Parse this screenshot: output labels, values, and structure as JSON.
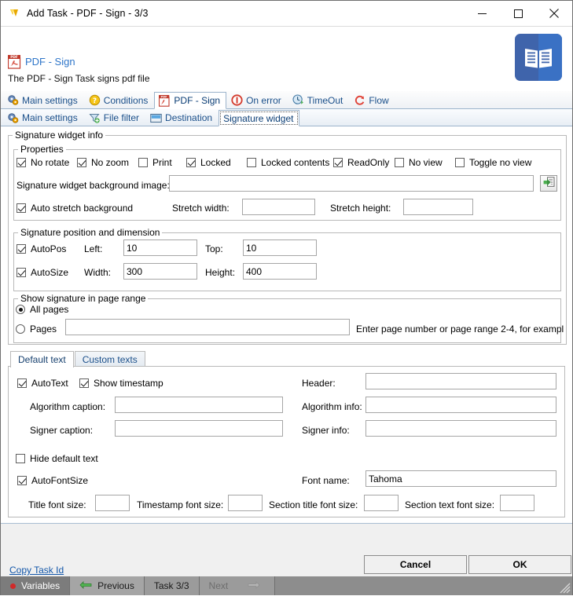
{
  "window": {
    "title": "Add Task - PDF - Sign - 3/3",
    "app_icon": "limagito-icon",
    "minimize": "minimize-icon",
    "maximize": "maximize-icon",
    "close": "close-icon"
  },
  "header": {
    "title": "PDF - Sign",
    "subtitle": "The PDF - Sign Task signs pdf file",
    "icon": "pdf-icon",
    "side_icon": "book-icon"
  },
  "tabs_primary": [
    {
      "label": "Main settings",
      "icon": "gears-icon",
      "active": false
    },
    {
      "label": "Conditions",
      "icon": "question-icon",
      "active": false
    },
    {
      "label": "PDF - Sign",
      "icon": "pdf-icon",
      "active": true
    },
    {
      "label": "On error",
      "icon": "error-icon",
      "active": false
    },
    {
      "label": "TimeOut",
      "icon": "timeout-icon",
      "active": false
    },
    {
      "label": "Flow",
      "icon": "flow-icon",
      "active": false
    }
  ],
  "tabs_secondary": [
    {
      "label": "Main settings",
      "icon": "gears-icon",
      "active": false
    },
    {
      "label": "File filter",
      "icon": "filter-icon",
      "active": false
    },
    {
      "label": "Destination",
      "icon": "destination-icon",
      "active": false
    },
    {
      "label": "Signature widget",
      "icon": "",
      "active": true
    }
  ],
  "groups": {
    "widget_info": "Signature widget info",
    "properties": "Properties",
    "position": "Signature position and dimension",
    "page_range": "Show signature in page range"
  },
  "properties": {
    "checks": [
      {
        "label": "No rotate",
        "checked": true
      },
      {
        "label": "No zoom",
        "checked": true
      },
      {
        "label": "Print",
        "checked": false
      },
      {
        "label": "Locked",
        "checked": true
      },
      {
        "label": "Locked contents",
        "checked": false
      },
      {
        "label": "ReadOnly",
        "checked": true
      },
      {
        "label": "No view",
        "checked": false
      },
      {
        "label": "Toggle no view",
        "checked": false
      }
    ],
    "background_image_label": "Signature widget background image:",
    "background_image_value": "",
    "browse_icon": "open-file-icon",
    "auto_stretch_label": "Auto stretch background",
    "auto_stretch_checked": true,
    "stretch_width_label": "Stretch width:",
    "stretch_width_value": "",
    "stretch_height_label": "Stretch height:",
    "stretch_height_value": ""
  },
  "position": {
    "autopos_label": "AutoPos",
    "autopos_checked": true,
    "left_label": "Left:",
    "left_value": "10",
    "top_label": "Top:",
    "top_value": "10",
    "autosize_label": "AutoSize",
    "autosize_checked": true,
    "width_label": "Width:",
    "width_value": "300",
    "height_label": "Height:",
    "height_value": "400"
  },
  "page_range": {
    "all_pages_label": "All pages",
    "all_pages_selected": true,
    "pages_label": "Pages",
    "pages_selected": false,
    "pages_value": "",
    "hint": "Enter page number or page range 2-4, for exampl"
  },
  "text_tabs": [
    {
      "label": "Default text",
      "active": true
    },
    {
      "label": "Custom texts",
      "active": false
    }
  ],
  "default_text": {
    "autotext_label": "AutoText",
    "autotext_checked": true,
    "show_timestamp_label": "Show timestamp",
    "show_timestamp_checked": true,
    "header_label": "Header:",
    "header_value": "",
    "algorithm_caption_label": "Algorithm caption:",
    "algorithm_caption_value": "",
    "algorithm_info_label": "Algorithm info:",
    "algorithm_info_value": "",
    "signer_caption_label": "Signer caption:",
    "signer_caption_value": "",
    "signer_info_label": "Signer info:",
    "signer_info_value": "",
    "hide_default_text_label": "Hide default text",
    "hide_default_text_checked": false,
    "autofontsize_label": "AutoFontSize",
    "autofontsize_checked": true,
    "font_name_label": "Font name:",
    "font_name_value": "Tahoma",
    "title_font_size_label": "Title font size:",
    "title_font_size_value": "",
    "timestamp_font_size_label": "Timestamp font size:",
    "timestamp_font_size_value": "",
    "section_title_font_size_label": "Section title font size:",
    "section_title_font_size_value": "",
    "section_text_font_size_label": "Section text font size:",
    "section_text_font_size_value": ""
  },
  "footer": {
    "copy_task_id": "Copy Task Id",
    "cancel": "Cancel",
    "ok": "OK"
  },
  "statusbar": {
    "variables": "Variables",
    "previous": "Previous",
    "task": "Task 3/3",
    "next": "Next"
  },
  "colors": {
    "accent_link": "#1155a8",
    "tab_text": "#1a4f8a",
    "header_title": "#2f76c9",
    "book_icon": "#3f64ab",
    "status_bar": "#8d8d8d",
    "red_dot": "#d02a2a"
  }
}
